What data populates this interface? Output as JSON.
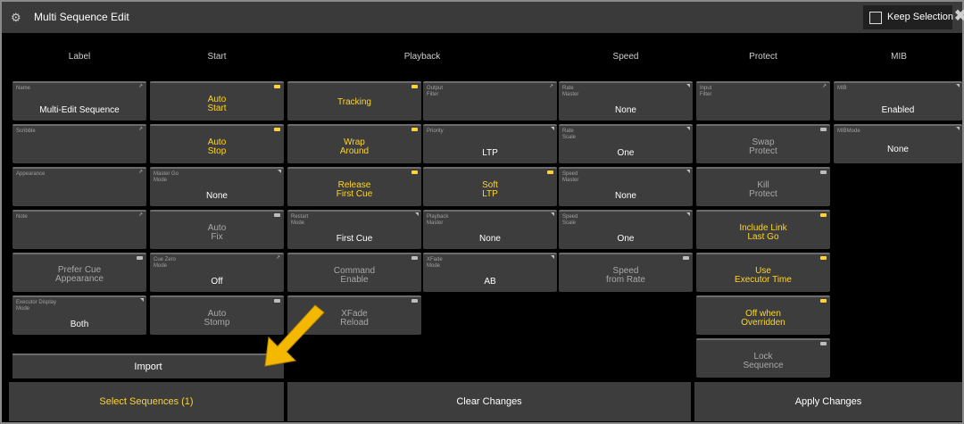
{
  "window": {
    "title": "Multi Sequence Edit",
    "keep_selection": "Keep Selection"
  },
  "columns": [
    "Label",
    "Start",
    "Playback",
    "Speed",
    "Protect",
    "MIB"
  ],
  "label_col": [
    {
      "label": "Name",
      "value": "Multi-Edit Sequence"
    },
    {
      "label": "Scribble",
      "value": ""
    },
    {
      "label": "Appearance",
      "value": ""
    },
    {
      "label": "Note",
      "value": ""
    },
    {
      "label": "",
      "value": "Prefer Cue\nAppearance"
    },
    {
      "label": "Executor Display\nMode",
      "value": "Both"
    }
  ],
  "start_col": [
    {
      "value": "Auto\nStart"
    },
    {
      "value": "Auto\nStop"
    },
    {
      "label": "Master Go\nMode",
      "value": "None"
    },
    {
      "value": "Auto\nFix"
    },
    {
      "label": "Cue Zero\nMode",
      "value": "Off"
    },
    {
      "value": "Auto\nStomp"
    }
  ],
  "playback_a": [
    {
      "value": "Tracking"
    },
    {
      "value": "Wrap\nAround"
    },
    {
      "value": "Release\nFirst Cue"
    },
    {
      "label": "Restart\nMode",
      "value": "First Cue"
    },
    {
      "value": "Command\nEnable"
    },
    {
      "value": "XFade\nReload"
    }
  ],
  "playback_b": [
    {
      "label": "Output\nFilter",
      "value": ""
    },
    {
      "label": "Priority",
      "value": "LTP"
    },
    {
      "value": "Soft\nLTP"
    },
    {
      "label": "Playback\nMaster",
      "value": "None"
    },
    {
      "label": "XFade\nMode",
      "value": "AB"
    }
  ],
  "speed_col": [
    {
      "label": "Rate\nMaster",
      "value": "None"
    },
    {
      "label": "Rate\nScale",
      "value": "One"
    },
    {
      "label": "Speed\nMaster",
      "value": "None"
    },
    {
      "label": "Speed\nScale",
      "value": "One"
    },
    {
      "value": "Speed\nfrom Rate"
    }
  ],
  "protect_col": [
    {
      "label": "Input\nFilter",
      "value": ""
    },
    {
      "value": "Swap\nProtect"
    },
    {
      "value": "Kill\nProtect"
    },
    {
      "value": "Include Link\nLast Go"
    },
    {
      "value": "Use\nExecutor Time"
    },
    {
      "value": "Off when\nOverridden"
    },
    {
      "value": "Lock\nSequence"
    }
  ],
  "mib_col": [
    {
      "label": "MIB",
      "value": "Enabled"
    },
    {
      "label": "MIBMode",
      "value": "None"
    }
  ],
  "import_label": "Import",
  "bottom": {
    "select": "Select Sequences (1)",
    "clear": "Clear Changes",
    "apply": "Apply Changes"
  },
  "colors": {
    "accent_yellow": "#ffd528",
    "arrow": "#f5b800",
    "button_bg": "#3d3d3d"
  },
  "icons": {
    "window": "sequence-icon",
    "close": "close-icon",
    "pointer": "arrow-icon"
  }
}
